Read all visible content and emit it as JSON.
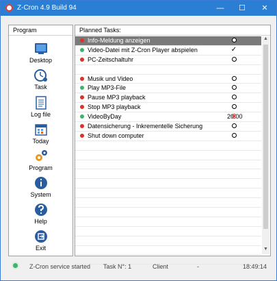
{
  "window": {
    "title": "Z-Cron 4.9 Build 94",
    "min": "—",
    "max": "☐",
    "close": "✕"
  },
  "sidebar": {
    "header": "Program",
    "items": [
      {
        "label": "Desktop",
        "icon": "desktop-icon"
      },
      {
        "label": "Task",
        "icon": "task-clock-icon"
      },
      {
        "label": "Log file",
        "icon": "log-file-icon"
      },
      {
        "label": "Today",
        "icon": "calendar-icon"
      },
      {
        "label": "Program",
        "icon": "gears-icon"
      },
      {
        "label": "System",
        "icon": "info-icon"
      },
      {
        "label": "Help",
        "icon": "help-icon"
      },
      {
        "label": "Exit",
        "icon": "exit-icon"
      }
    ]
  },
  "tasks": {
    "header": "Planned Tasks:",
    "rows": [
      {
        "name": "Info-Meldung anzeigen",
        "dot": "#d9342b",
        "time": "",
        "state": "circle",
        "selected": true
      },
      {
        "name": "Video-Datei mit Z-Cron Player abspielen",
        "dot": "#3cb371",
        "time": "",
        "state": "check"
      },
      {
        "name": "PC-Zeitschaltuhr",
        "dot": "#d9342b",
        "time": "",
        "state": "circle"
      },
      {
        "name": "",
        "dot": "",
        "time": "",
        "state": ""
      },
      {
        "name": "Musik und Video",
        "dot": "#d9342b",
        "time": "",
        "state": "circle"
      },
      {
        "name": "Play MP3-File",
        "dot": "#3cb371",
        "time": "",
        "state": "circle"
      },
      {
        "name": "Pause MP3 playback",
        "dot": "#d9342b",
        "time": "",
        "state": "circle"
      },
      {
        "name": "Stop MP3 playback",
        "dot": "#d9342b",
        "time": "",
        "state": "circle"
      },
      {
        "name": "VideoByDay",
        "dot": "#3cb371",
        "time": "20:00",
        "state": "circle-red"
      },
      {
        "name": "Datensicherung - Inkrementelle Sicherung",
        "dot": "#d9342b",
        "time": "",
        "state": "circle"
      },
      {
        "name": "Shut down computer",
        "dot": "#d9342b",
        "time": "",
        "state": "circle"
      }
    ],
    "check_glyph": "✓"
  },
  "statusbar": {
    "service": "Z-Cron service started",
    "task_no": "Task N°: 1",
    "role": "Client",
    "sep": "-",
    "clock": "18:49:14"
  }
}
